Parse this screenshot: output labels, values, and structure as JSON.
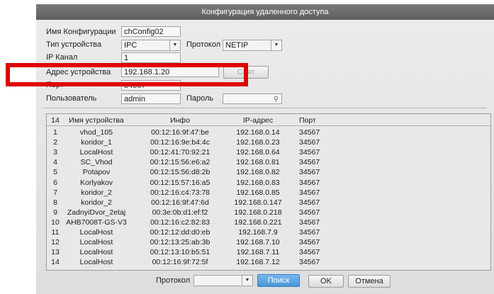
{
  "dialog": {
    "title": "Конфигурация удаленного доступа",
    "config_name_label": "Имя Конфигурации",
    "config_name_value": "chConfig02",
    "device_type_label": "Тип устройства",
    "device_type_value": "IPC",
    "protocol_label": "Протокол",
    "protocol_value": "NETIP",
    "channel_label": "IP Канал",
    "channel_value": "1",
    "address_label": "Адрес устройства",
    "address_value": "192.168.1.20",
    "address_button": "Свят",
    "port_label": "Порт",
    "port_value": "34567",
    "user_label": "Пользователь",
    "user_value": "admin",
    "password_label": "Пароль",
    "password_icon": "key-icon"
  },
  "table": {
    "headers": [
      "14",
      "Имя устройства",
      "Инфо",
      "IP-адрес",
      "Порт"
    ],
    "rows": [
      [
        "1",
        "vhod_105",
        "00:12:16:9f:47:be",
        "192.168.0.14",
        "34567"
      ],
      [
        "2",
        "koridor_1",
        "00:12:16:9e:b4:4c",
        "192.168.0.23",
        "34567"
      ],
      [
        "3",
        "LocalHost",
        "00:12:41:70:92:21",
        "192.168.0.64",
        "34567"
      ],
      [
        "4",
        "SC_Vhod",
        "00:12:15:56:e6:a2",
        "192.168.0.81",
        "34567"
      ],
      [
        "5",
        "Potapov",
        "00:12:15:56:d8:2b",
        "192.168.0.82",
        "34567"
      ],
      [
        "6",
        "Korlyakov",
        "00:12:15:57:16:a5",
        "192.168.0.83",
        "34567"
      ],
      [
        "7",
        "koridor_2",
        "00:12:16:c4:73:78",
        "192.168.0.85",
        "34567"
      ],
      [
        "8",
        "koridor_2",
        "00:12:16:9f:47:6d",
        "192.168.0.147",
        "34567"
      ],
      [
        "9",
        "ZadnyiDvor_2etaj",
        "00:3e:0b:d1:ef:f2",
        "192.168.0.218",
        "34567"
      ],
      [
        "10",
        "AHB7008T-GS-V3",
        "00:12:16:c2:82:83",
        "192.168.0.221",
        "34567"
      ],
      [
        "11",
        "LocalHost",
        "00:12:12:dd:d0:eb",
        "192.168.7.9",
        "34567"
      ],
      [
        "12",
        "LocalHost",
        "00:12:13:25:ab:3b",
        "192.168.7.10",
        "34567"
      ],
      [
        "13",
        "LocalHost",
        "00:12:13:10:b5:51",
        "192.168.7.11",
        "34567"
      ],
      [
        "14",
        "LocalHost",
        "00:12:16:9f:72:5f",
        "192.168.7.12",
        "34567"
      ]
    ]
  },
  "footer": {
    "protocol_label": "Протокол",
    "protocol_value": "",
    "search_button": "Поиск",
    "ok_button": "OK",
    "cancel_button": "Отмена"
  },
  "colors": {
    "highlight": "#e00000",
    "search_button": "#5aa3e0"
  }
}
